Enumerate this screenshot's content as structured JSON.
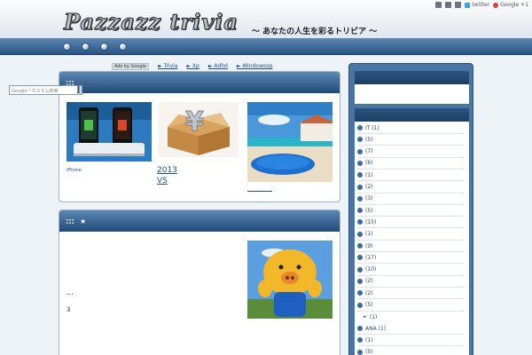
{
  "header": {
    "logo": "Pazzazz trivia",
    "tagline": "～ あなたの人生を彩るトリビア ～",
    "links": {
      "twitter": "twitter",
      "google": "Google +1"
    }
  },
  "ads": {
    "badge": "Ads by Google",
    "links": [
      "► Trivia",
      "► Xp",
      "► Adhd",
      "► Windowsxp"
    ]
  },
  "panel1": {
    "caption_small": "iPhone",
    "caption_link_line1": "2013",
    "caption_link_line2": "VS"
  },
  "panel2": {
    "ellipsis": "...",
    "three": "3"
  },
  "sidebar": {
    "search_placeholder": "Google™カスタム検索",
    "categories": [
      {
        "label": "IT",
        "count": "(1)"
      },
      {
        "label": "",
        "count": "(5)"
      },
      {
        "label": "",
        "count": "(7)"
      },
      {
        "label": "",
        "count": "(6)"
      },
      {
        "label": "",
        "count": "(1)"
      },
      {
        "label": "",
        "count": "(2)"
      },
      {
        "label": "",
        "count": "(3)"
      },
      {
        "label": "",
        "count": "(5)"
      },
      {
        "label": "",
        "count": "(15)"
      },
      {
        "label": "",
        "count": "(1)"
      },
      {
        "label": "",
        "count": "(9)"
      },
      {
        "label": "",
        "count": "(17)"
      },
      {
        "label": "",
        "count": "(10)"
      },
      {
        "label": "",
        "count": "(2)"
      },
      {
        "label": "",
        "count": "(2)"
      },
      {
        "label": "",
        "count": "(5)"
      },
      {
        "label": "",
        "count": "(1)",
        "sub": true
      },
      {
        "label": "ANA",
        "count": "(1)"
      },
      {
        "label": "",
        "count": "(1)"
      },
      {
        "label": "",
        "count": "(5)"
      }
    ]
  }
}
